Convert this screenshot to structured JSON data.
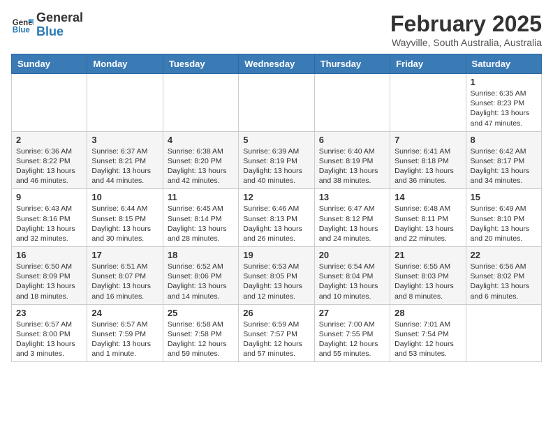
{
  "header": {
    "logo_general": "General",
    "logo_blue": "Blue",
    "month_title": "February 2025",
    "location": "Wayville, South Australia, Australia"
  },
  "days_of_week": [
    "Sunday",
    "Monday",
    "Tuesday",
    "Wednesday",
    "Thursday",
    "Friday",
    "Saturday"
  ],
  "weeks": [
    [
      {
        "day": "",
        "info": ""
      },
      {
        "day": "",
        "info": ""
      },
      {
        "day": "",
        "info": ""
      },
      {
        "day": "",
        "info": ""
      },
      {
        "day": "",
        "info": ""
      },
      {
        "day": "",
        "info": ""
      },
      {
        "day": "1",
        "info": "Sunrise: 6:35 AM\nSunset: 8:23 PM\nDaylight: 13 hours and 47 minutes."
      }
    ],
    [
      {
        "day": "2",
        "info": "Sunrise: 6:36 AM\nSunset: 8:22 PM\nDaylight: 13 hours and 46 minutes."
      },
      {
        "day": "3",
        "info": "Sunrise: 6:37 AM\nSunset: 8:21 PM\nDaylight: 13 hours and 44 minutes."
      },
      {
        "day": "4",
        "info": "Sunrise: 6:38 AM\nSunset: 8:20 PM\nDaylight: 13 hours and 42 minutes."
      },
      {
        "day": "5",
        "info": "Sunrise: 6:39 AM\nSunset: 8:19 PM\nDaylight: 13 hours and 40 minutes."
      },
      {
        "day": "6",
        "info": "Sunrise: 6:40 AM\nSunset: 8:19 PM\nDaylight: 13 hours and 38 minutes."
      },
      {
        "day": "7",
        "info": "Sunrise: 6:41 AM\nSunset: 8:18 PM\nDaylight: 13 hours and 36 minutes."
      },
      {
        "day": "8",
        "info": "Sunrise: 6:42 AM\nSunset: 8:17 PM\nDaylight: 13 hours and 34 minutes."
      }
    ],
    [
      {
        "day": "9",
        "info": "Sunrise: 6:43 AM\nSunset: 8:16 PM\nDaylight: 13 hours and 32 minutes."
      },
      {
        "day": "10",
        "info": "Sunrise: 6:44 AM\nSunset: 8:15 PM\nDaylight: 13 hours and 30 minutes."
      },
      {
        "day": "11",
        "info": "Sunrise: 6:45 AM\nSunset: 8:14 PM\nDaylight: 13 hours and 28 minutes."
      },
      {
        "day": "12",
        "info": "Sunrise: 6:46 AM\nSunset: 8:13 PM\nDaylight: 13 hours and 26 minutes."
      },
      {
        "day": "13",
        "info": "Sunrise: 6:47 AM\nSunset: 8:12 PM\nDaylight: 13 hours and 24 minutes."
      },
      {
        "day": "14",
        "info": "Sunrise: 6:48 AM\nSunset: 8:11 PM\nDaylight: 13 hours and 22 minutes."
      },
      {
        "day": "15",
        "info": "Sunrise: 6:49 AM\nSunset: 8:10 PM\nDaylight: 13 hours and 20 minutes."
      }
    ],
    [
      {
        "day": "16",
        "info": "Sunrise: 6:50 AM\nSunset: 8:09 PM\nDaylight: 13 hours and 18 minutes."
      },
      {
        "day": "17",
        "info": "Sunrise: 6:51 AM\nSunset: 8:07 PM\nDaylight: 13 hours and 16 minutes."
      },
      {
        "day": "18",
        "info": "Sunrise: 6:52 AM\nSunset: 8:06 PM\nDaylight: 13 hours and 14 minutes."
      },
      {
        "day": "19",
        "info": "Sunrise: 6:53 AM\nSunset: 8:05 PM\nDaylight: 13 hours and 12 minutes."
      },
      {
        "day": "20",
        "info": "Sunrise: 6:54 AM\nSunset: 8:04 PM\nDaylight: 13 hours and 10 minutes."
      },
      {
        "day": "21",
        "info": "Sunrise: 6:55 AM\nSunset: 8:03 PM\nDaylight: 13 hours and 8 minutes."
      },
      {
        "day": "22",
        "info": "Sunrise: 6:56 AM\nSunset: 8:02 PM\nDaylight: 13 hours and 6 minutes."
      }
    ],
    [
      {
        "day": "23",
        "info": "Sunrise: 6:57 AM\nSunset: 8:00 PM\nDaylight: 13 hours and 3 minutes."
      },
      {
        "day": "24",
        "info": "Sunrise: 6:57 AM\nSunset: 7:59 PM\nDaylight: 13 hours and 1 minute."
      },
      {
        "day": "25",
        "info": "Sunrise: 6:58 AM\nSunset: 7:58 PM\nDaylight: 12 hours and 59 minutes."
      },
      {
        "day": "26",
        "info": "Sunrise: 6:59 AM\nSunset: 7:57 PM\nDaylight: 12 hours and 57 minutes."
      },
      {
        "day": "27",
        "info": "Sunrise: 7:00 AM\nSunset: 7:55 PM\nDaylight: 12 hours and 55 minutes."
      },
      {
        "day": "28",
        "info": "Sunrise: 7:01 AM\nSunset: 7:54 PM\nDaylight: 12 hours and 53 minutes."
      },
      {
        "day": "",
        "info": ""
      }
    ]
  ]
}
